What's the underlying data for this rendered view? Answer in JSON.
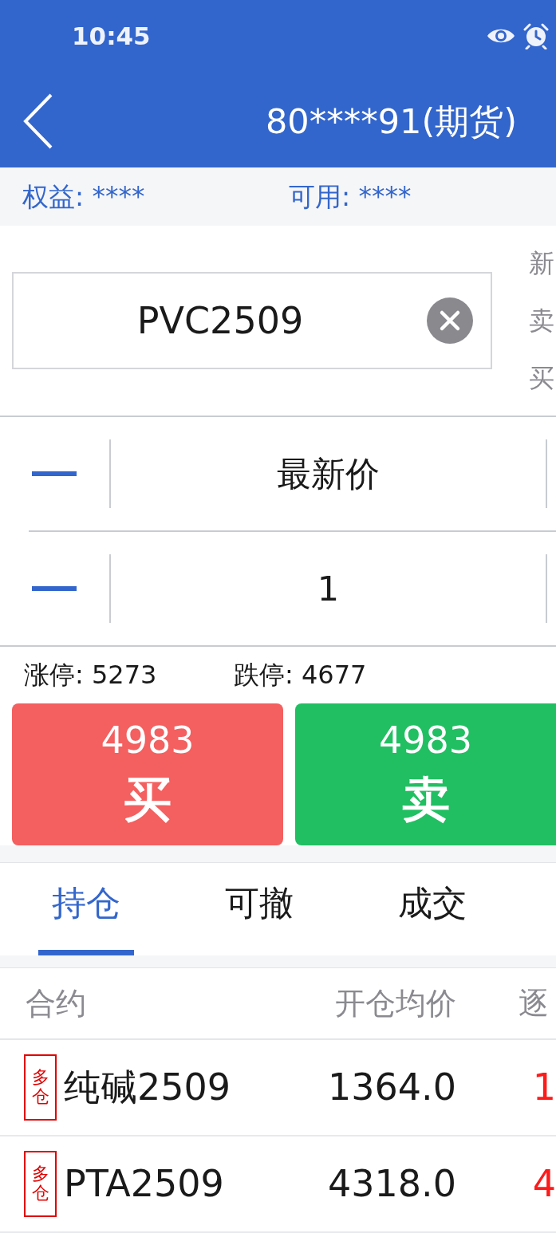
{
  "status_bar": {
    "time": "10:45"
  },
  "nav": {
    "title": "80****91(期货)"
  },
  "account": [
    "权益: ****",
    "可用: ****"
  ],
  "order": {
    "contract": "PVC2509",
    "side_labels": [
      "新",
      "卖",
      "买"
    ],
    "price": "最新价",
    "quantity": "1",
    "limits": [
      "涨停: 5273",
      "跌停: 4677"
    ]
  },
  "trade_buttons": [
    {
      "kind": "buy",
      "price": "4983",
      "label": "买"
    },
    {
      "kind": "sell",
      "price": "4983",
      "label": "卖"
    }
  ],
  "tabs": [
    {
      "label": "持仓",
      "selected": true
    },
    {
      "label": "可撤",
      "selected": false
    },
    {
      "label": "成交",
      "selected": false
    }
  ],
  "positions": {
    "columns": [
      "合约",
      "开仓均价",
      "逐"
    ],
    "rows": [
      {
        "tag": "多仓",
        "contract": "纯碱2509",
        "avg_price": "1364.0",
        "column_3": "1"
      },
      {
        "tag": "多仓",
        "contract": "PTA2509",
        "avg_price": "4318.0",
        "column_3": "4"
      }
    ]
  }
}
